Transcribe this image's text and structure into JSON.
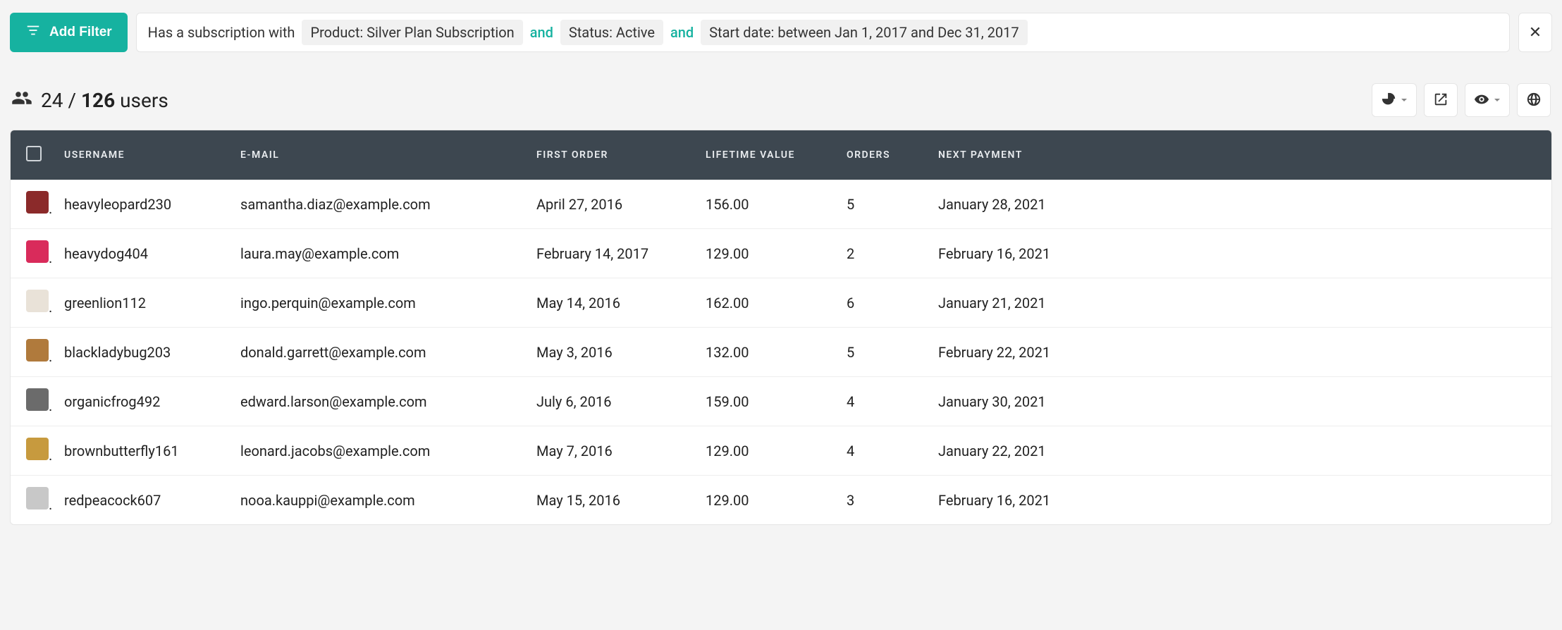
{
  "filter": {
    "add_label": "Add Filter",
    "prefix": "Has a subscription with",
    "and": "and",
    "chips": [
      "Product: Silver Plan Subscription",
      "Status: Active",
      "Start date: between Jan 1, 2017 and Dec 31, 2017"
    ],
    "clear_glyph": "✕"
  },
  "summary": {
    "shown": "24",
    "sep": "/",
    "total": "126",
    "users_word": "users"
  },
  "columns": {
    "username": "USERNAME",
    "email": "E-MAIL",
    "first_order": "FIRST ORDER",
    "ltv": "LIFETIME VALUE",
    "orders": "ORDERS",
    "next_payment": "NEXT PAYMENT"
  },
  "rows": [
    {
      "avatar_color": "#8b2a2a",
      "username": "heavyleopard230",
      "email": "samantha.diaz@example.com",
      "first_order": "April 27, 2016",
      "ltv": "156.00",
      "orders": "5",
      "next_payment": "January 28, 2021"
    },
    {
      "avatar_color": "#d92b5b",
      "username": "heavydog404",
      "email": "laura.may@example.com",
      "first_order": "February 14, 2017",
      "ltv": "129.00",
      "orders": "2",
      "next_payment": "February 16, 2021"
    },
    {
      "avatar_color": "#e9e2d8",
      "username": "greenlion112",
      "email": "ingo.perquin@example.com",
      "first_order": "May 14, 2016",
      "ltv": "162.00",
      "orders": "6",
      "next_payment": "January 21, 2021"
    },
    {
      "avatar_color": "#b07a3c",
      "username": "blackladybug203",
      "email": "donald.garrett@example.com",
      "first_order": "May 3, 2016",
      "ltv": "132.00",
      "orders": "5",
      "next_payment": "February 22, 2021"
    },
    {
      "avatar_color": "#6b6b6b",
      "username": "organicfrog492",
      "email": "edward.larson@example.com",
      "first_order": "July 6, 2016",
      "ltv": "159.00",
      "orders": "4",
      "next_payment": "January 30, 2021"
    },
    {
      "avatar_color": "#c79a3e",
      "username": "brownbutterfly161",
      "email": "leonard.jacobs@example.com",
      "first_order": "May 7, 2016",
      "ltv": "129.00",
      "orders": "4",
      "next_payment": "January 22, 2021"
    },
    {
      "avatar_color": "#c8c8c8",
      "username": "redpeacock607",
      "email": "nooa.kauppi@example.com",
      "first_order": "May 15, 2016",
      "ltv": "129.00",
      "orders": "3",
      "next_payment": "February 16, 2021"
    }
  ]
}
